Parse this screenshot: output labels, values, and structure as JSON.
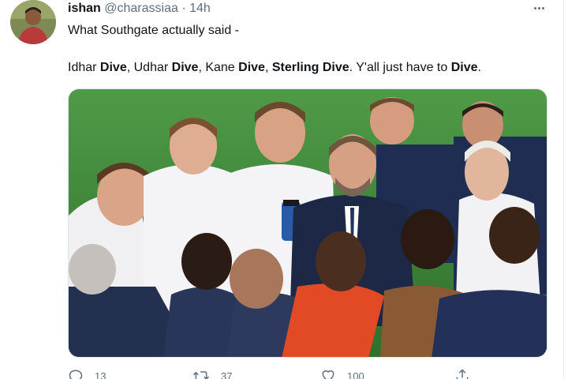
{
  "tweet": {
    "display_name": "ishan",
    "handle": "@charassiaa",
    "separator": "·",
    "time": "14h",
    "line1": "What Southgate actually said -",
    "line2": [
      {
        "text": "Idhar ",
        "bold": false
      },
      {
        "text": "Dive",
        "bold": true
      },
      {
        "text": ", Udhar ",
        "bold": false
      },
      {
        "text": "Dive",
        "bold": true
      },
      {
        "text": ", Kane ",
        "bold": false
      },
      {
        "text": "Dive",
        "bold": true
      },
      {
        "text": ", ",
        "bold": false
      },
      {
        "text": "Sterling Dive",
        "bold": true
      },
      {
        "text": ". Y'all just have to ",
        "bold": false
      },
      {
        "text": "Dive",
        "bold": true
      },
      {
        "text": ".",
        "bold": false
      }
    ],
    "media_description": "England players huddled around manager in a team talk on the pitch",
    "actions": {
      "reply_count": "13",
      "retweet_count": "37",
      "like_count": "100"
    }
  },
  "icons": [
    "more-icon",
    "reply-icon",
    "retweet-icon",
    "like-icon",
    "share-icon"
  ],
  "colors": {
    "text": "#0f1419",
    "secondary": "#5b7083",
    "pitch": "#3f8a3a",
    "navy": "#1f2d52"
  }
}
